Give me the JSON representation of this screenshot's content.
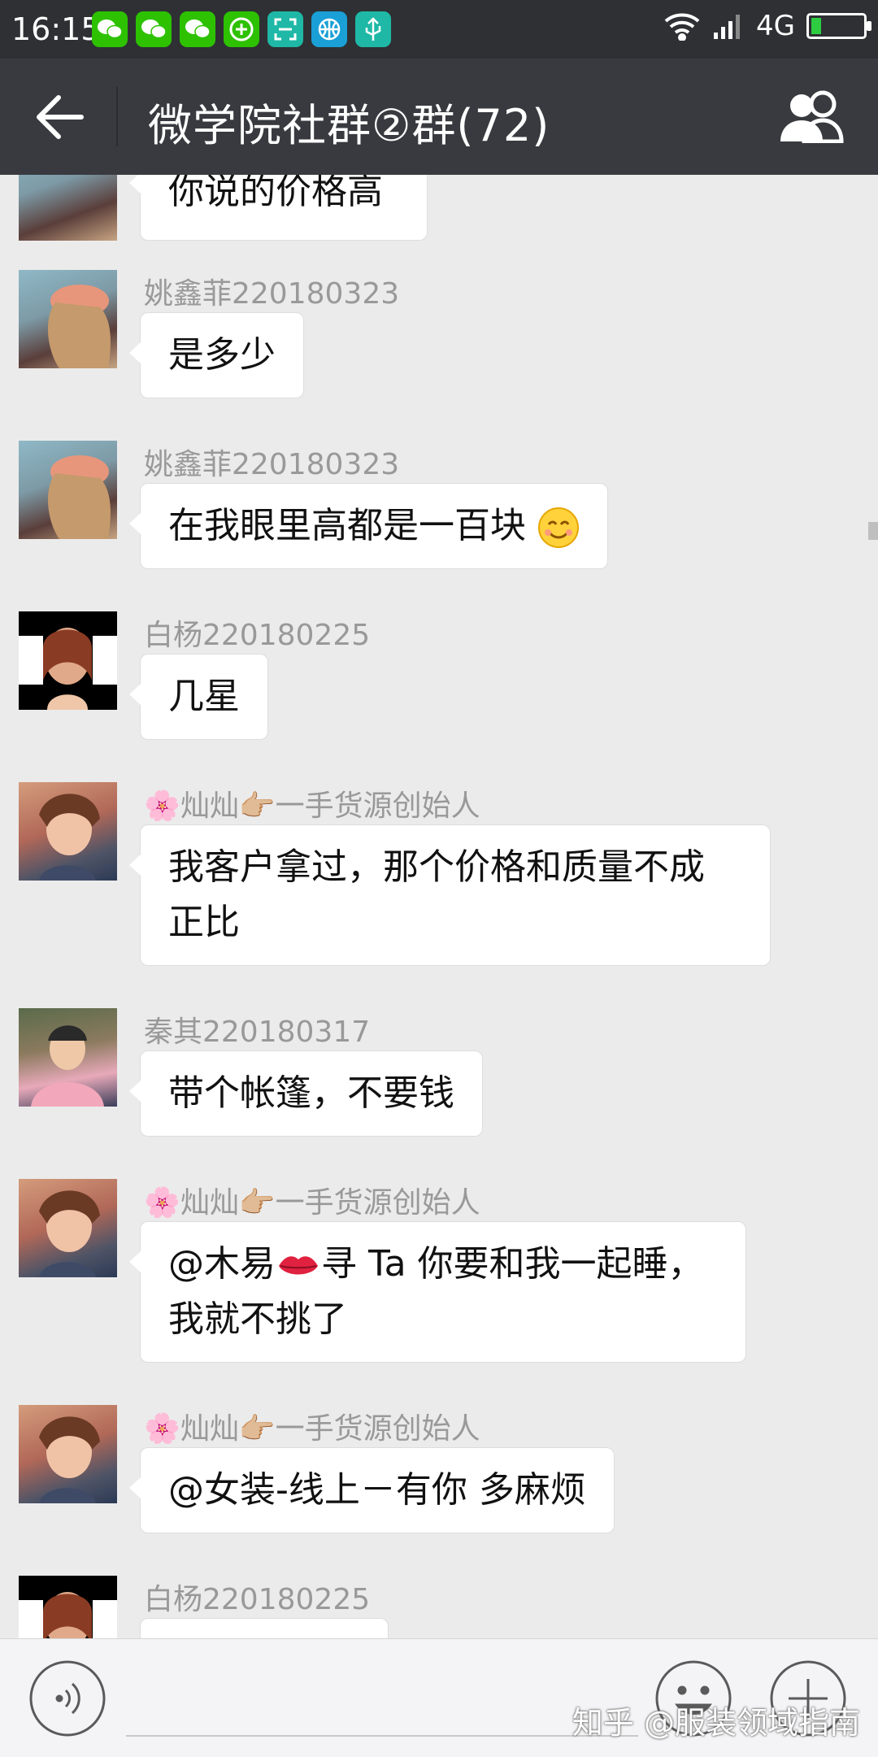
{
  "status_bar": {
    "time": "16:15",
    "network": "4G",
    "battery_level": 0.2,
    "app_icons": [
      {
        "name": "wechat-icon",
        "color": "#2dc100"
      },
      {
        "name": "wechat-icon",
        "color": "#2dc100"
      },
      {
        "name": "wechat-icon",
        "color": "#2dc100"
      },
      {
        "name": "plus-circle-icon",
        "color": "#2dc100"
      },
      {
        "name": "scan-icon",
        "color": "#1fb8a6"
      },
      {
        "name": "basketball-icon",
        "color": "#1a9fd6"
      },
      {
        "name": "usb-icon",
        "color": "#1fb8a6"
      }
    ]
  },
  "header": {
    "title": "微学院社群②群(72)",
    "background": "#393a3f"
  },
  "messages": [
    {
      "sender": "",
      "text": "你说的价格高"
    },
    {
      "sender": "姚鑫菲220180323",
      "text": "是多少"
    },
    {
      "sender": "姚鑫菲220180323",
      "text": "在我眼里高都是一百块"
    },
    {
      "sender": "白杨220180225",
      "text": "几星"
    },
    {
      "sender_prefix": "🌸",
      "sender": "灿灿",
      "sender_suffix": "👉🏼一手货源创始人",
      "text_lines": [
        "我客户拿过，那个价格和质量不成",
        "正比"
      ]
    },
    {
      "sender": "秦其220180317",
      "text": "带个帐篷，不要钱"
    },
    {
      "sender_prefix": "🌸",
      "sender": "灿灿",
      "sender_suffix": "👉🏼一手货源创始人",
      "text_line1_a": "@木易",
      "text_line1_b": "寻 Ta  你要和我一起睡，",
      "text_line2": "我就不挑了"
    },
    {
      "sender_prefix": "🌸",
      "sender": "灿灿",
      "sender_suffix": "👉🏼一手货源创始人",
      "text": "@女装-线上－有你  多麻烦"
    },
    {
      "sender": "白杨220180225",
      "text": ""
    }
  ],
  "watermark": "知乎 @服装领域指南",
  "emoji": {
    "smile": "smile-emoji",
    "lips": "lips-emoji"
  }
}
